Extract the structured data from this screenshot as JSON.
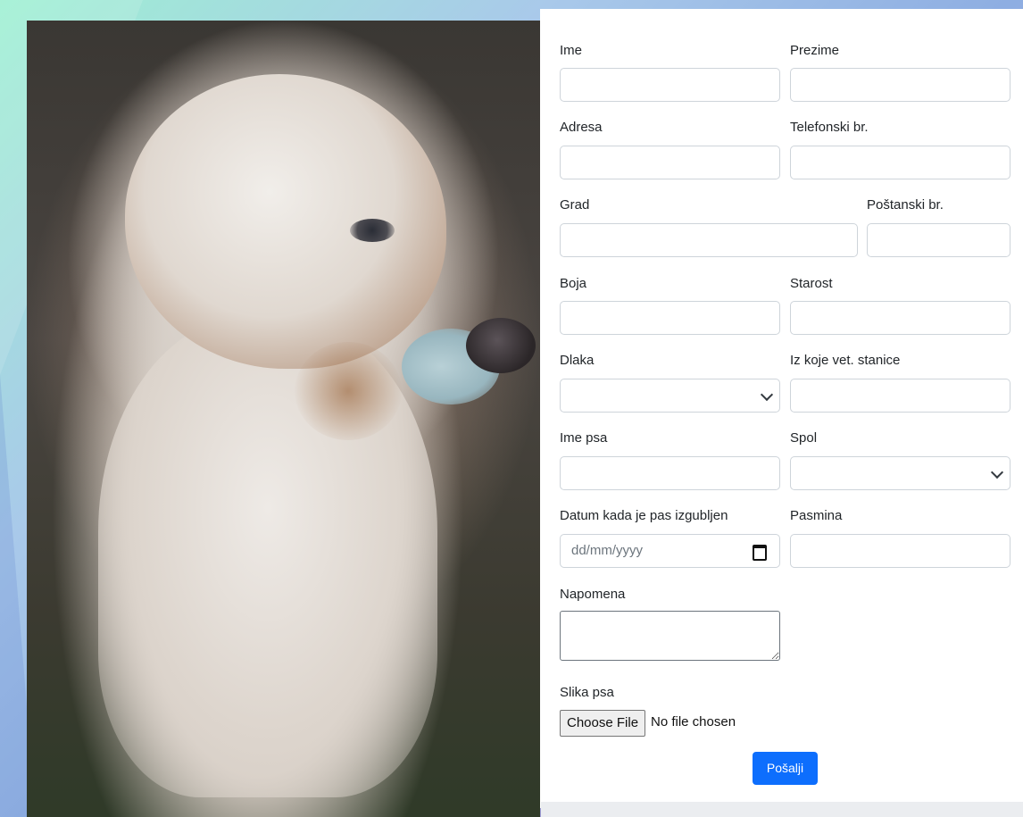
{
  "form": {
    "labels": {
      "ime": "Ime",
      "prezime": "Prezime",
      "adresa": "Adresa",
      "telefon": "Telefonski br.",
      "grad": "Grad",
      "postanski": "Poštanski br.",
      "boja": "Boja",
      "starost": "Starost",
      "dlaka": "Dlaka",
      "vet_stanica": "Iz koje vet. stanice",
      "ime_psa": "Ime psa",
      "spol": "Spol",
      "datum": "Datum kada je pas izgubljen",
      "pasmina": "Pasmina",
      "napomena": "Napomena",
      "slika": "Slika psa"
    },
    "date_placeholder": "dd/mm/yyyy",
    "file_button": "Choose File",
    "file_status": "No file chosen",
    "submit": "Pošalji"
  },
  "icons": {
    "calendar": "calendar-icon",
    "chevron": "chevron-down-icon"
  },
  "colors": {
    "primary": "#0d6efd",
    "border": "#ced4da",
    "text": "#212529"
  }
}
